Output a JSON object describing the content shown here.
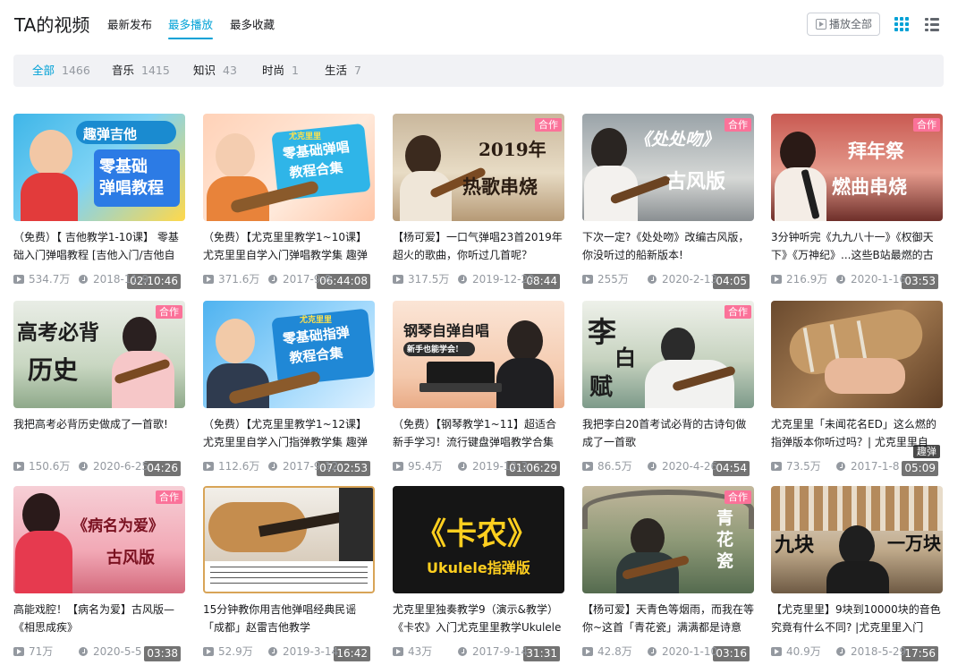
{
  "header": {
    "title": "TA的视频",
    "sort_tabs": [
      "最新发布",
      "最多播放",
      "最多收藏"
    ],
    "active_sort": "最多播放",
    "play_all": "播放全部"
  },
  "filters": [
    {
      "label": "全部",
      "count": "1466"
    },
    {
      "label": "音乐",
      "count": "1415"
    },
    {
      "label": "知识",
      "count": "43"
    },
    {
      "label": "时尚",
      "count": "1"
    },
    {
      "label": "生活",
      "count": "7"
    }
  ],
  "videos": [
    {
      "title": "（免费）【 吉他教学1-10课】 零基础入门弹唱教程 [吉他入门/吉他自",
      "duration": "02:10:46",
      "views": "534.7万",
      "date": "2018-11-9",
      "tag": "",
      "thumb_text": "趣弹吉他 零基础弹唱教程"
    },
    {
      "title": "（免费）【尤克里里教学1~10课】尤克里里自学入门弹唱教学集 趣弹",
      "duration": "06:44:08",
      "views": "371.6万",
      "date": "2017-9-8",
      "tag": "",
      "thumb_text": "尤克里里 零基础弹唱 教程合集"
    },
    {
      "title": "【杨可爱】一口气弹唱23首2019年超火的歌曲，你听过几首呢？",
      "duration": "08:44",
      "views": "317.5万",
      "date": "2019-12-22",
      "tag": "合作",
      "thumb_text": "2019年 热歌串烧"
    },
    {
      "title": "下次一定?《处处吻》改编古风版，你没听过的船新版本!",
      "duration": "04:05",
      "views": "255万",
      "date": "2020-2-13",
      "tag": "合作",
      "thumb_text": "《处处吻》古风版"
    },
    {
      "title": "3分钟听完《九九八十一》《权御天下》《万神纪》...这些B站最燃的古",
      "duration": "03:53",
      "views": "216.9万",
      "date": "2020-1-16",
      "tag": "合作",
      "thumb_text": "拜年祭 燃曲串烧"
    },
    {
      "title": "我把高考必背历史做成了一首歌!",
      "duration": "04:26",
      "views": "150.6万",
      "date": "2020-6-25",
      "tag": "合作",
      "thumb_text": "高考必背 历史"
    },
    {
      "title": "（免费）【尤克里里教学1~12课】尤克里里自学入门指弹教学集 趣弹",
      "duration": "07:02:53",
      "views": "112.6万",
      "date": "2017-9-12",
      "tag": "",
      "thumb_text": "尤克里里 零基础指弹 教程合集"
    },
    {
      "title": "（免费）【钢琴教学1~11】超适合新手学习！流行键盘弹唱教学合集",
      "duration": "01:06:29",
      "views": "95.4万",
      "date": "2019-12-3",
      "tag": "",
      "thumb_text": "钢琴自弹自唱 新手也能学会!"
    },
    {
      "title": "我把李白20首考试必背的古诗句做成了一首歌",
      "duration": "04:54",
      "views": "86.5万",
      "date": "2020-4-26",
      "tag": "合作",
      "thumb_text": "李白赋"
    },
    {
      "title": "尤克里里「未闻花名ED」这么燃的指弹版本你听过吗？| 尤克里里自",
      "duration": "05:09",
      "views": "73.5万",
      "date": "2017-1-8",
      "tag": "趣弹",
      "thumb_text": ""
    },
    {
      "title": "高能戏腔！【病名为爱】古风版—《相思成疾》",
      "duration": "03:38",
      "views": "71万",
      "date": "2020-5-5",
      "tag": "合作",
      "thumb_text": "《病名为爱》古风版"
    },
    {
      "title": "15分钟教你用吉他弹唱经典民谣「成都」赵雷吉他教学",
      "duration": "16:42",
      "views": "52.9万",
      "date": "2019-3-14",
      "tag": "",
      "thumb_text": ""
    },
    {
      "title": "尤克里里独奏教学9（演示&教学）《卡农》入门尤克里里教学Ukulele",
      "duration": "31:31",
      "views": "43万",
      "date": "2017-9-14",
      "tag": "",
      "thumb_text": "《卡农》 Ukulele指弹版"
    },
    {
      "title": "【杨可爱】天青色等烟雨，而我在等你~这首「青花瓷」满满都是诗意",
      "duration": "03:16",
      "views": "42.8万",
      "date": "2020-1-10",
      "tag": "合作",
      "thumb_text": "青花瓷"
    },
    {
      "title": "【尤克里里】9块到10000块的音色究竟有什么不同? |尤克里里入门",
      "duration": "17:56",
      "views": "40.9万",
      "date": "2018-5-29",
      "tag": "",
      "thumb_text": "九块 一万块"
    }
  ],
  "colors": {
    "accent": "#00a1d6",
    "tag_pink": "#fb7299",
    "muted": "#9499a0"
  }
}
